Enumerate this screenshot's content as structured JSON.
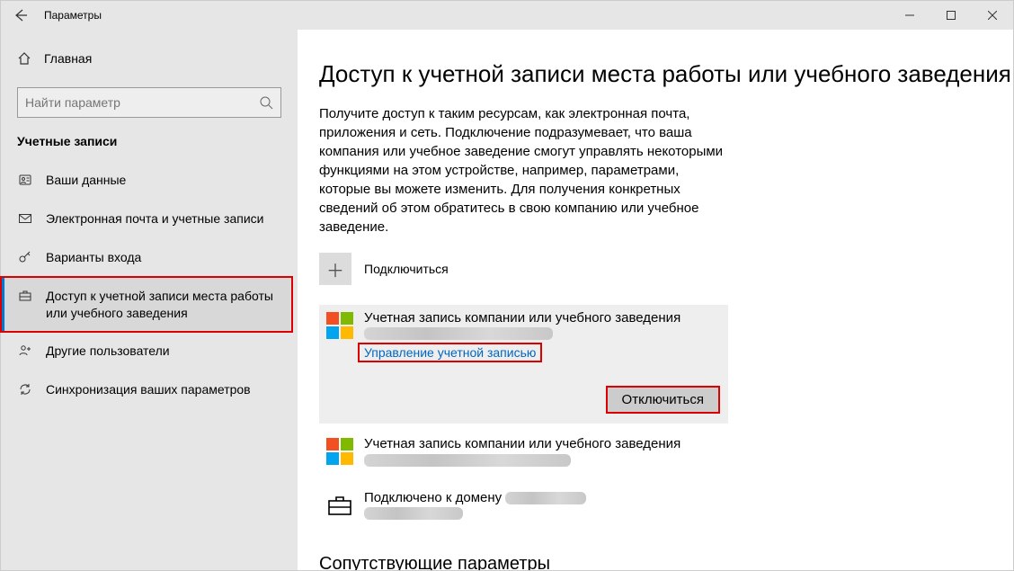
{
  "titlebar": {
    "title": "Параметры"
  },
  "sidebar": {
    "home": "Главная",
    "search_placeholder": "Найти параметр",
    "category": "Учетные записи",
    "items": [
      {
        "label": "Ваши данные"
      },
      {
        "label": "Электронная почта и учетные записи"
      },
      {
        "label": "Варианты входа"
      },
      {
        "label": "Доступ к учетной записи места работы или учебного заведения"
      },
      {
        "label": "Другие пользователи"
      },
      {
        "label": "Синхронизация ваших параметров"
      }
    ]
  },
  "main": {
    "title": "Доступ к учетной записи места работы или учебного заведения",
    "description": "Получите доступ к таким ресурсам, как электронная почта, приложения и сеть. Подключение подразумевает, что ваша компания или учебное заведение смогут управлять некоторыми функциями на этом устройстве, например, параметрами, которые вы можете изменить. Для получения конкретных сведений об этом обратитесь в свою компанию или учебное заведение.",
    "connect_label": "Подключиться",
    "account1": {
      "title": "Учетная запись компании или учебного заведения",
      "manage": "Управление учетной записью",
      "disconnect": "Отключиться"
    },
    "account2": {
      "title": "Учетная запись компании или учебного заведения"
    },
    "domain": {
      "title_prefix": "Подключено к домену "
    },
    "related_title": "Сопутствующие параметры"
  }
}
